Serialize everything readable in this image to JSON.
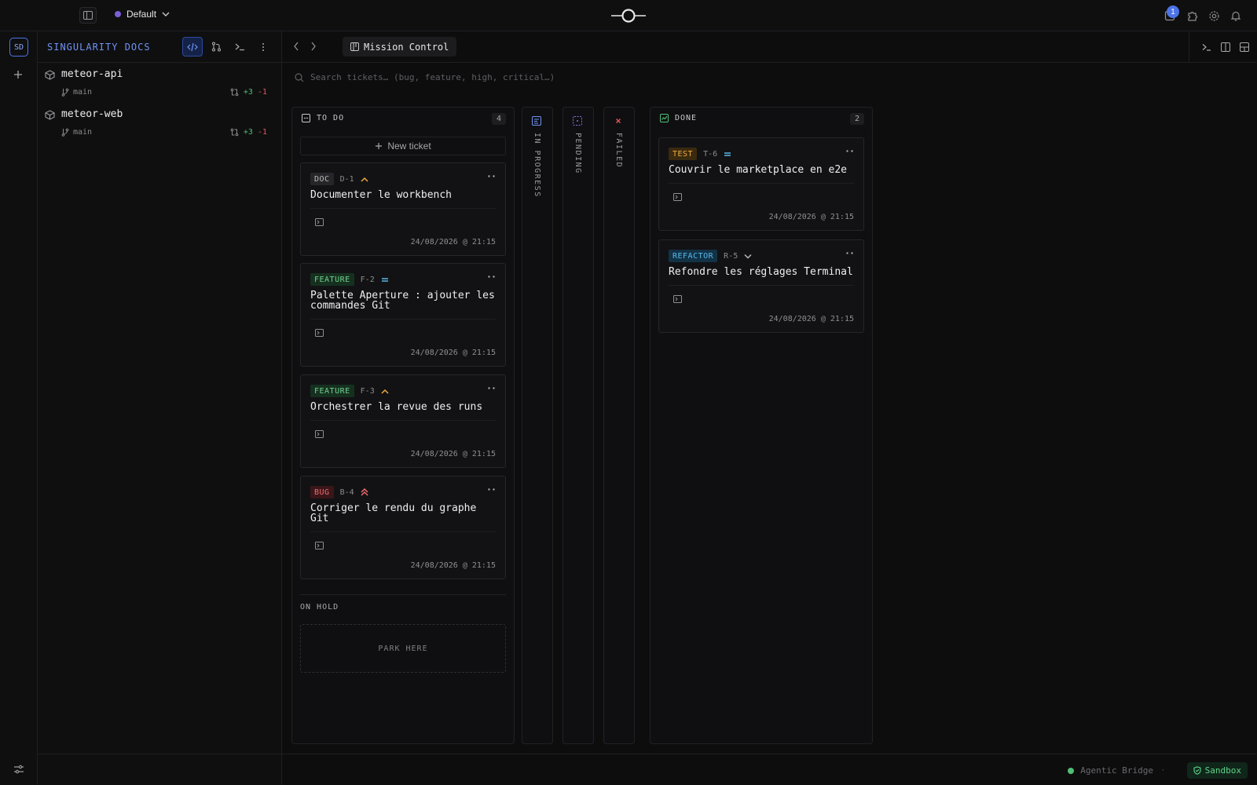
{
  "topbar": {
    "workspace": "Default",
    "workspace_color": "#7b5fd6",
    "notification_count": "1",
    "icons": [
      "sidebar-toggle-icon",
      "chevron-down-icon",
      "logo-icon",
      "puzzle-icon",
      "gear-icon",
      "bell-icon"
    ]
  },
  "rail": {
    "project_badge": "SD"
  },
  "sidebar": {
    "title": "SINGULARITY DOCS",
    "repos": [
      {
        "name": "meteor-api",
        "branch": "main",
        "added": "+3",
        "removed": "-1"
      },
      {
        "name": "meteor-web",
        "branch": "main",
        "added": "+3",
        "removed": "-1"
      }
    ]
  },
  "main": {
    "tab": "Mission Control",
    "search_placeholder": "Search tickets… (bug, feature, high, critical…)"
  },
  "board": {
    "todo": {
      "title": "TO DO",
      "count": "4",
      "new_ticket": "New ticket",
      "cards": [
        {
          "tag": "DOC",
          "id": "D-1",
          "priority": "high",
          "title": "Documenter le workbench",
          "date": "24/08/2026 @ 21:15"
        },
        {
          "tag": "FEATURE",
          "id": "F-2",
          "priority": "medium",
          "title": "Palette Aperture : ajouter les commandes Git",
          "date": "24/08/2026 @ 21:15"
        },
        {
          "tag": "FEATURE",
          "id": "F-3",
          "priority": "high",
          "title": "Orchestrer la revue des runs",
          "date": "24/08/2026 @ 21:15"
        },
        {
          "tag": "BUG",
          "id": "B-4",
          "priority": "critical",
          "title": "Corriger le rendu du graphe Git",
          "date": "24/08/2026 @ 21:15"
        }
      ],
      "on_hold": "ON HOLD",
      "park_here": "PARK HERE"
    },
    "in_progress": {
      "title": "IN PROGRESS"
    },
    "pending": {
      "title": "PENDING"
    },
    "failed": {
      "title": "FAILED"
    },
    "done": {
      "title": "DONE",
      "count": "2",
      "cards": [
        {
          "tag": "TEST",
          "id": "T-6",
          "priority": "medium",
          "title": "Couvrir le marketplace en e2e",
          "date": "24/08/2026 @ 21:15"
        },
        {
          "tag": "REFACTOR",
          "id": "R-5",
          "priority": "low",
          "title": "Refondre les réglages Terminal",
          "date": "24/08/2026 @ 21:15"
        }
      ]
    }
  },
  "footer": {
    "bridge": "Agentic Bridge",
    "separator": "·",
    "sandbox": "Sandbox"
  },
  "colors": {
    "accent": "#4c74e8",
    "success": "#4fbf74",
    "danger": "#e25a5a",
    "warning": "#f0aa3c"
  }
}
